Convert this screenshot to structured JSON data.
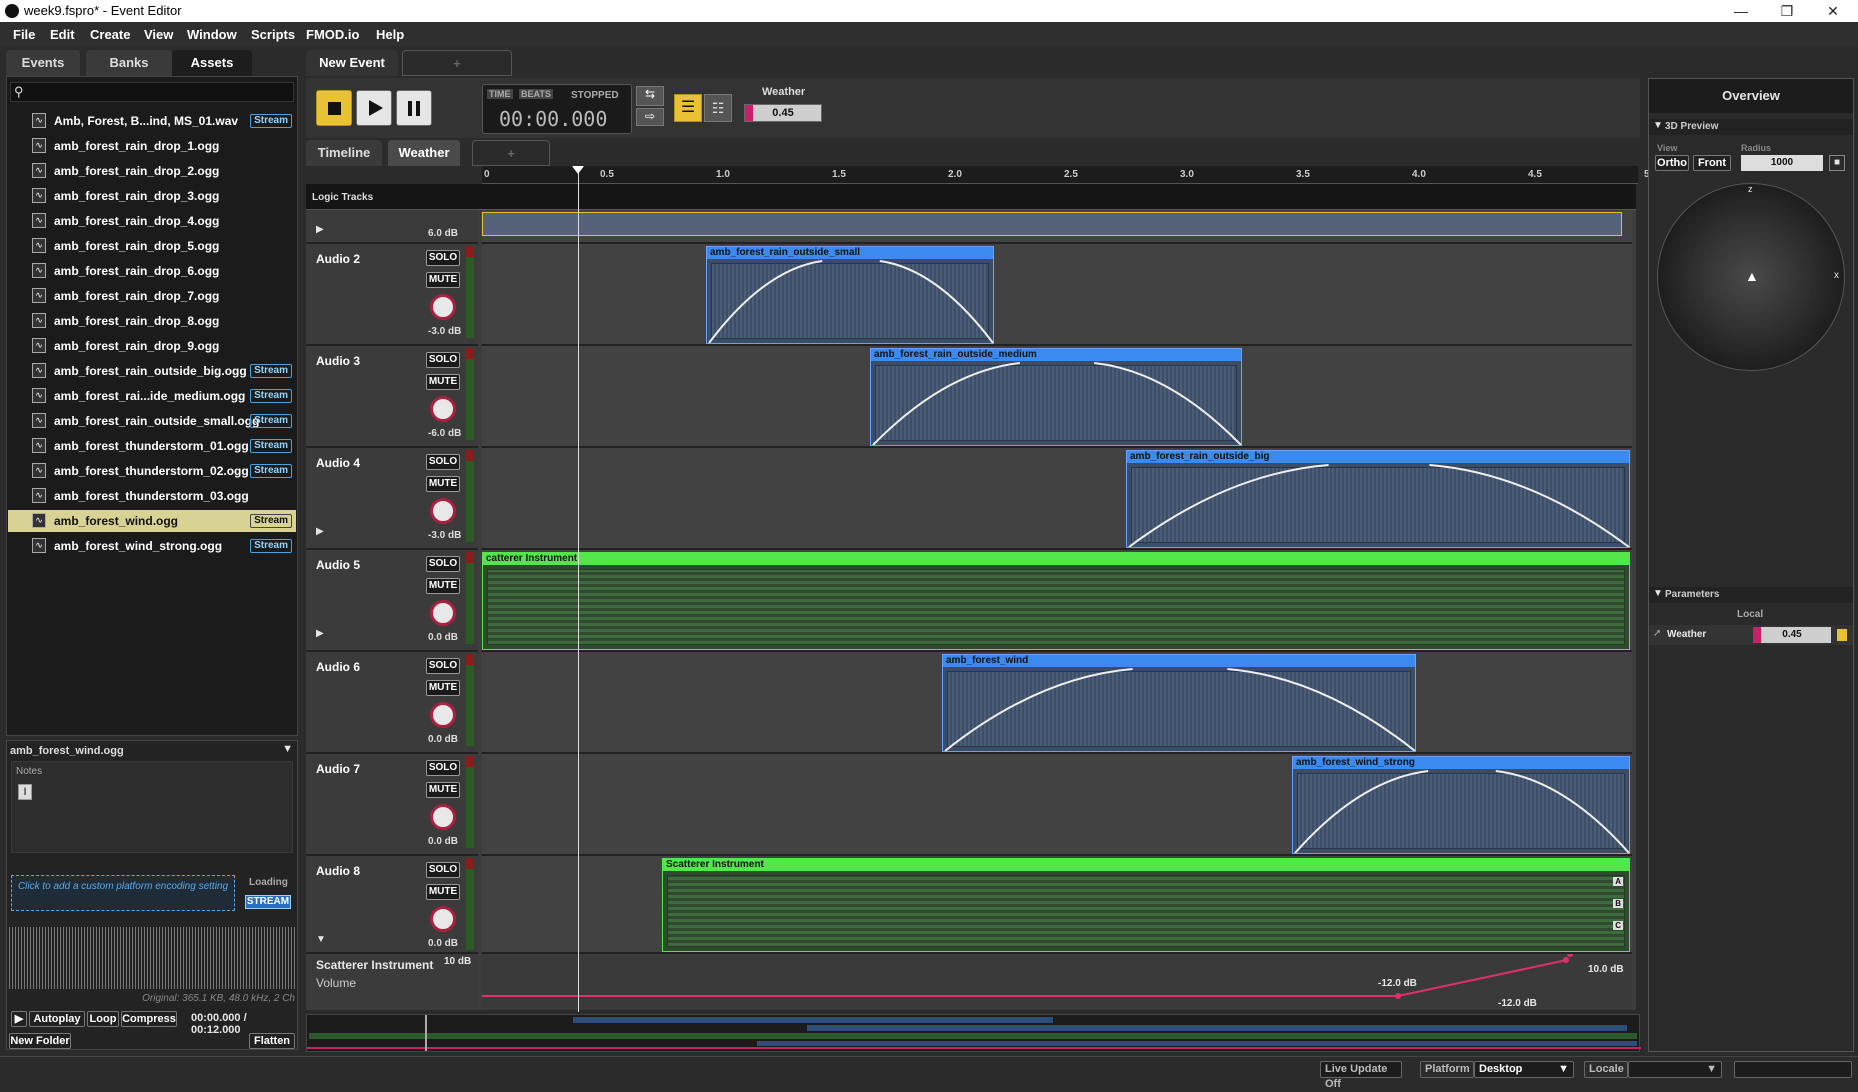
{
  "title": "week9.fspro* - Event Editor",
  "menu": [
    "File",
    "Edit",
    "Create",
    "View",
    "Window",
    "Scripts",
    "FMOD.io",
    "Help"
  ],
  "left_tabs": [
    "Events",
    "Banks",
    "Assets"
  ],
  "assets": [
    {
      "name": "Amb, Forest, B...ind, MS_01.wav",
      "badge": "Stream"
    },
    {
      "name": "amb_forest_rain_drop_1.ogg",
      "badge": ""
    },
    {
      "name": "amb_forest_rain_drop_2.ogg",
      "badge": ""
    },
    {
      "name": "amb_forest_rain_drop_3.ogg",
      "badge": ""
    },
    {
      "name": "amb_forest_rain_drop_4.ogg",
      "badge": ""
    },
    {
      "name": "amb_forest_rain_drop_5.ogg",
      "badge": ""
    },
    {
      "name": "amb_forest_rain_drop_6.ogg",
      "badge": ""
    },
    {
      "name": "amb_forest_rain_drop_7.ogg",
      "badge": ""
    },
    {
      "name": "amb_forest_rain_drop_8.ogg",
      "badge": ""
    },
    {
      "name": "amb_forest_rain_drop_9.ogg",
      "badge": ""
    },
    {
      "name": "amb_forest_rain_outside_big.ogg",
      "badge": "Stream"
    },
    {
      "name": "amb_forest_rai...ide_medium.ogg",
      "badge": "Stream"
    },
    {
      "name": "amb_forest_rain_outside_small.ogg",
      "badge": "Stream"
    },
    {
      "name": "amb_forest_thunderstorm_01.ogg",
      "badge": "Stream"
    },
    {
      "name": "amb_forest_thunderstorm_02.ogg",
      "badge": "Stream"
    },
    {
      "name": "amb_forest_thunderstorm_03.ogg",
      "badge": ""
    },
    {
      "name": "amb_forest_wind.ogg",
      "badge": "Stream"
    },
    {
      "name": "amb_forest_wind_strong.ogg",
      "badge": "Stream"
    }
  ],
  "info": {
    "selected": "amb_forest_wind.ogg",
    "notes_label": "Notes",
    "custom_platform": "Click to add a custom platform encoding setting",
    "loading_label": "Loading",
    "loading_value": "STREAM",
    "original": "Original: 365.1 KB, 48.0 kHz, 2 Ch",
    "autoplay": "Autoplay",
    "loop": "Loop",
    "compress": "Compress",
    "time": "00:00.000 / 00:12.000",
    "new_folder": "New Folder",
    "flatten": "Flatten"
  },
  "event_tab": "New Event",
  "add_tab": "+",
  "transport": {
    "time_label": "TIME",
    "beats_label": "BEATS",
    "state": "STOPPED",
    "time": "00:00.000",
    "param_name": "Weather",
    "param_value": "0.45"
  },
  "sub_tabs": [
    "Timeline",
    "Weather"
  ],
  "ruler": [
    "0",
    "0.5",
    "1.0",
    "1.5",
    "2.0",
    "2.5",
    "3.0",
    "3.5",
    "4.0",
    "4.5",
    "5."
  ],
  "logic_tracks_label": "Logic Tracks",
  "tracks": [
    {
      "name": "",
      "db": "6.0 dB"
    },
    {
      "name": "Audio 2",
      "db": "-3.0 dB"
    },
    {
      "name": "Audio 3",
      "db": "-6.0 dB"
    },
    {
      "name": "Audio 4",
      "db": "-3.0 dB"
    },
    {
      "name": "Audio 5",
      "db": "0.0 dB"
    },
    {
      "name": "Audio 6",
      "db": "0.0 dB"
    },
    {
      "name": "Audio 7",
      "db": "0.0 dB"
    },
    {
      "name": "Audio 8",
      "db": "0.0 dB"
    }
  ],
  "solo": "SOLO",
  "mute": "MUTE",
  "clips": [
    {
      "label": "amb_forest_rain_outside_small"
    },
    {
      "label": "amb_forest_rain_outside_medium"
    },
    {
      "label": "amb_forest_rain_outside_big"
    },
    {
      "label": "catterer Instrument"
    },
    {
      "label": "amb_forest_wind"
    },
    {
      "label": "amb_forest_wind_strong"
    },
    {
      "label": "Scatterer Instrument"
    }
  ],
  "scatter_letters": [
    "A",
    "B",
    "C"
  ],
  "automation": {
    "name": "Scatterer Instrument",
    "sub": "Volume",
    "db_top": "10 dB",
    "left_label": "-12.0 dB",
    "right_label": "10.0 dB",
    "bottom_label": "-12.0 dB"
  },
  "overview": {
    "title": "Overview",
    "preview_label": "3D Preview",
    "view_label": "View",
    "radius_label": "Radius",
    "ortho": "Ortho",
    "front": "Front",
    "radius": "1000",
    "axis_z": "z",
    "axis_x": "x",
    "params_label": "Parameters",
    "local_label": "Local",
    "param_name": "Weather",
    "param_value": "0.45"
  },
  "status": {
    "live_update": "Live Update Off",
    "platform_label": "Platform",
    "platform": "Desktop",
    "locale_label": "Locale"
  },
  "colors": {
    "accent": "#e8c234",
    "clip_blue": "#3b8af0",
    "clip_green": "#53e64a",
    "selected_row": "#d8d294"
  }
}
